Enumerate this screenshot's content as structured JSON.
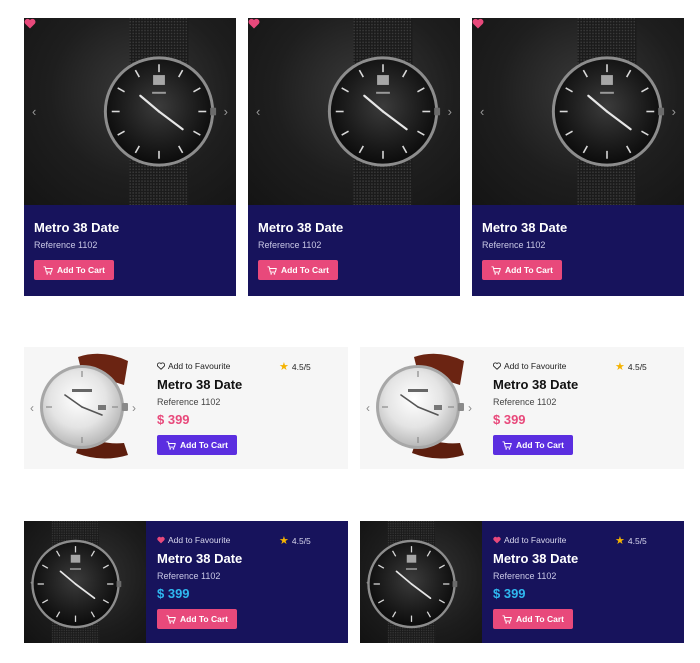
{
  "colors": {
    "navy": "#17135c",
    "pink": "#e8497b",
    "purple": "#5b2ee0",
    "cyan": "#2fb8f0",
    "star": "#f5b301"
  },
  "dark_cards": [
    {
      "title": "Metro 38 Date",
      "reference": "Reference 1102",
      "button": "Add To Cart",
      "favourited": true
    },
    {
      "title": "Metro 38 Date",
      "reference": "Reference 1102",
      "button": "Add To Cart",
      "favourited": true
    },
    {
      "title": "Metro 38 Date",
      "reference": "Reference 1102",
      "button": "Add To Cart",
      "favourited": true
    }
  ],
  "light_cards": [
    {
      "favourite": "Add to Favourite",
      "rating": "4.5/5",
      "title": "Metro 38 Date",
      "reference": "Reference 1102",
      "price": "$ 399",
      "button": "Add To Cart"
    },
    {
      "favourite": "Add to Favourite",
      "rating": "4.5/5",
      "title": "Metro 38 Date",
      "reference": "Reference 1102",
      "price": "$ 399",
      "button": "Add To Cart"
    }
  ],
  "navy_cards": [
    {
      "favourite": "Add to Favourite",
      "rating": "4.5/5",
      "title": "Metro 38 Date",
      "reference": "Reference 1102",
      "price": "$ 399",
      "button": "Add To Cart"
    },
    {
      "favourite": "Add to Favourite",
      "rating": "4.5/5",
      "title": "Metro 38 Date",
      "reference": "Reference 1102",
      "price": "$ 399",
      "button": "Add To Cart"
    }
  ],
  "icons": {
    "heart": "heart-icon",
    "cart": "cart-icon",
    "star": "star-icon",
    "prev": "chevron-left-icon",
    "next": "chevron-right-icon"
  }
}
